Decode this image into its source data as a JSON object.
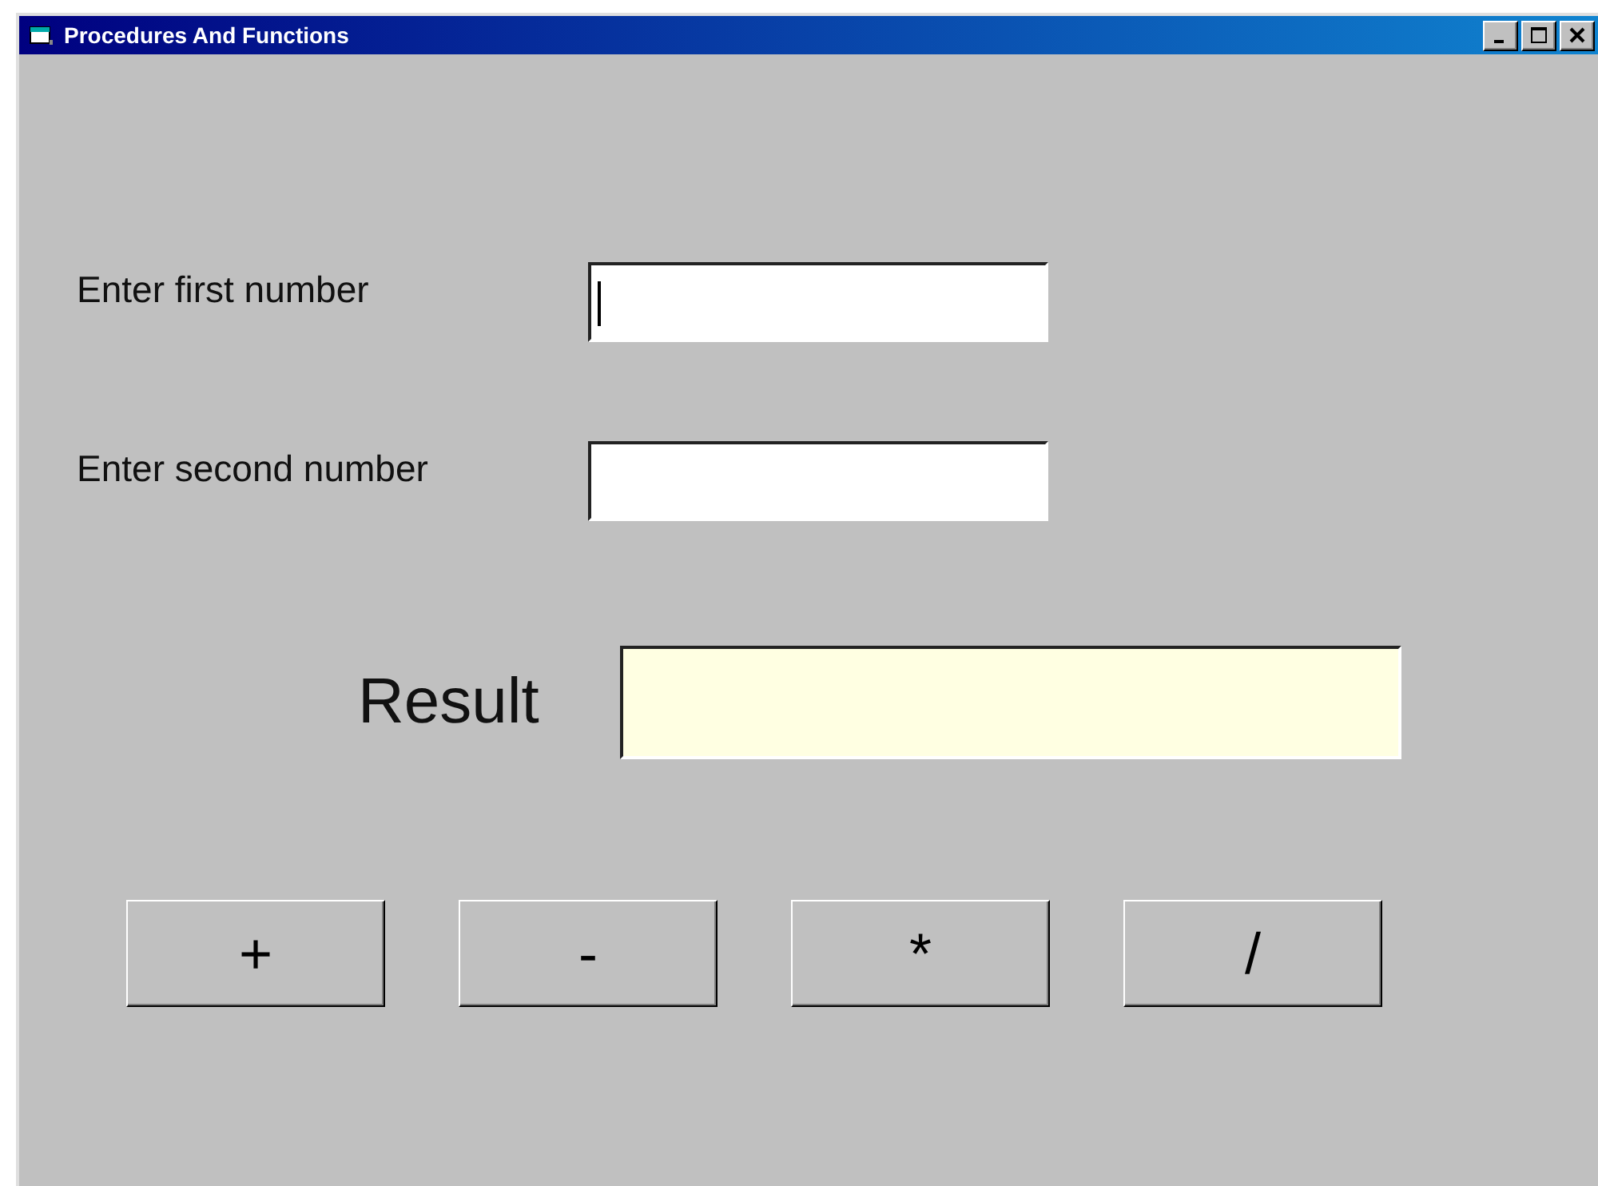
{
  "window": {
    "title": "Procedures And Functions"
  },
  "inputs": [
    {
      "label": "Enter first number",
      "focused": true
    },
    {
      "label": "Enter second number",
      "focused": false
    }
  ],
  "result": {
    "label": "Result"
  },
  "buttons": [
    "+",
    "-",
    "*",
    "/"
  ]
}
